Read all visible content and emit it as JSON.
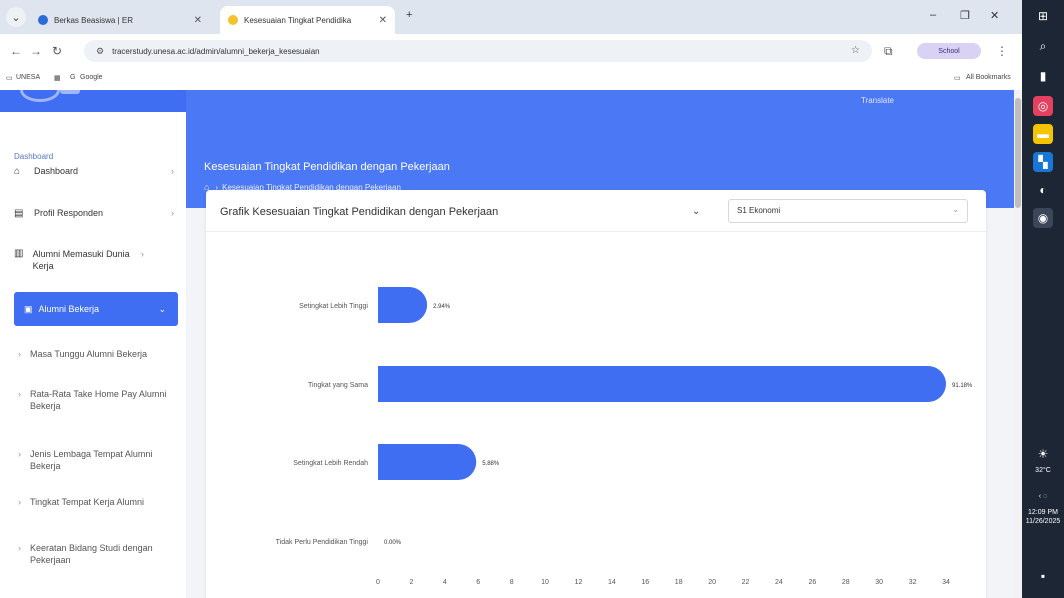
{
  "browser": {
    "tab_inactive": "Berkas Beasiswa | ER",
    "tab_active": "Kesesuaian Tingkat Pendidika",
    "url": "tracerstudy.unesa.ac.id/admin/alumni_bekerja_kesesuaian",
    "profile": "School",
    "bookmarks": [
      {
        "label": "UNESA"
      },
      {
        "label": "Google"
      }
    ],
    "all_bookmarks": "All Bookmarks"
  },
  "sidebar": {
    "section_title": "Dashboard",
    "items": [
      {
        "label": "Dashboard",
        "icon": "home-icon"
      },
      {
        "label": "Profil Responden",
        "icon": "user-id-icon"
      },
      {
        "label": "Alumni Memasuki Dunia Kerja",
        "icon": "building-icon"
      }
    ],
    "active_item": {
      "label": "Alumni Bekerja",
      "icon": "briefcase-icon"
    },
    "sub_items": [
      {
        "label": "Masa Tunggu Alumni Bekerja"
      },
      {
        "label": "Rata-Rata Take Home Pay Alumni Bekerja"
      },
      {
        "label": "Jenis Lembaga Tempat Alumni Bekerja"
      },
      {
        "label": "Tingkat Tempat Kerja Alumni"
      },
      {
        "label": "Keeratan Bidang Studi dengan Pekerjaan"
      }
    ]
  },
  "header": {
    "top_right": "Translate",
    "page_title": "Kesesuaian Tingkat Pendidikan dengan Pekerjaan",
    "breadcrumb": "Kesesuaian Tingkat Pendidikan dengan Pekerjaan"
  },
  "card": {
    "title": "Grafik Kesesuaian Tingkat Pendidikan dengan Pekerjaan",
    "select_value": "S1 Ekonomi"
  },
  "chart_data": {
    "type": "bar",
    "orientation": "horizontal",
    "categories": [
      "Setingkat Lebih Tinggi",
      "Tingkat yang Sama",
      "Setingkat Lebih Rendah",
      "Tidak Perlu Pendidikan Tinggi"
    ],
    "values": [
      2.94,
      91.18,
      5.88,
      0.0
    ],
    "data_labels": [
      "2.94%",
      "91.18%",
      "5.88%",
      "0.00%"
    ],
    "x_ticks": [
      0,
      2,
      4,
      6,
      8,
      10,
      12,
      14,
      16,
      18,
      20,
      22,
      24,
      26,
      28,
      30,
      32,
      34
    ],
    "xlim": [
      0,
      34
    ],
    "bar_color": "#3f6ef3",
    "rounded_ends": true,
    "grid": false
  },
  "taskbar": {
    "weather": "32°C",
    "time": "12:09 PM",
    "date": "11/26/2025"
  }
}
